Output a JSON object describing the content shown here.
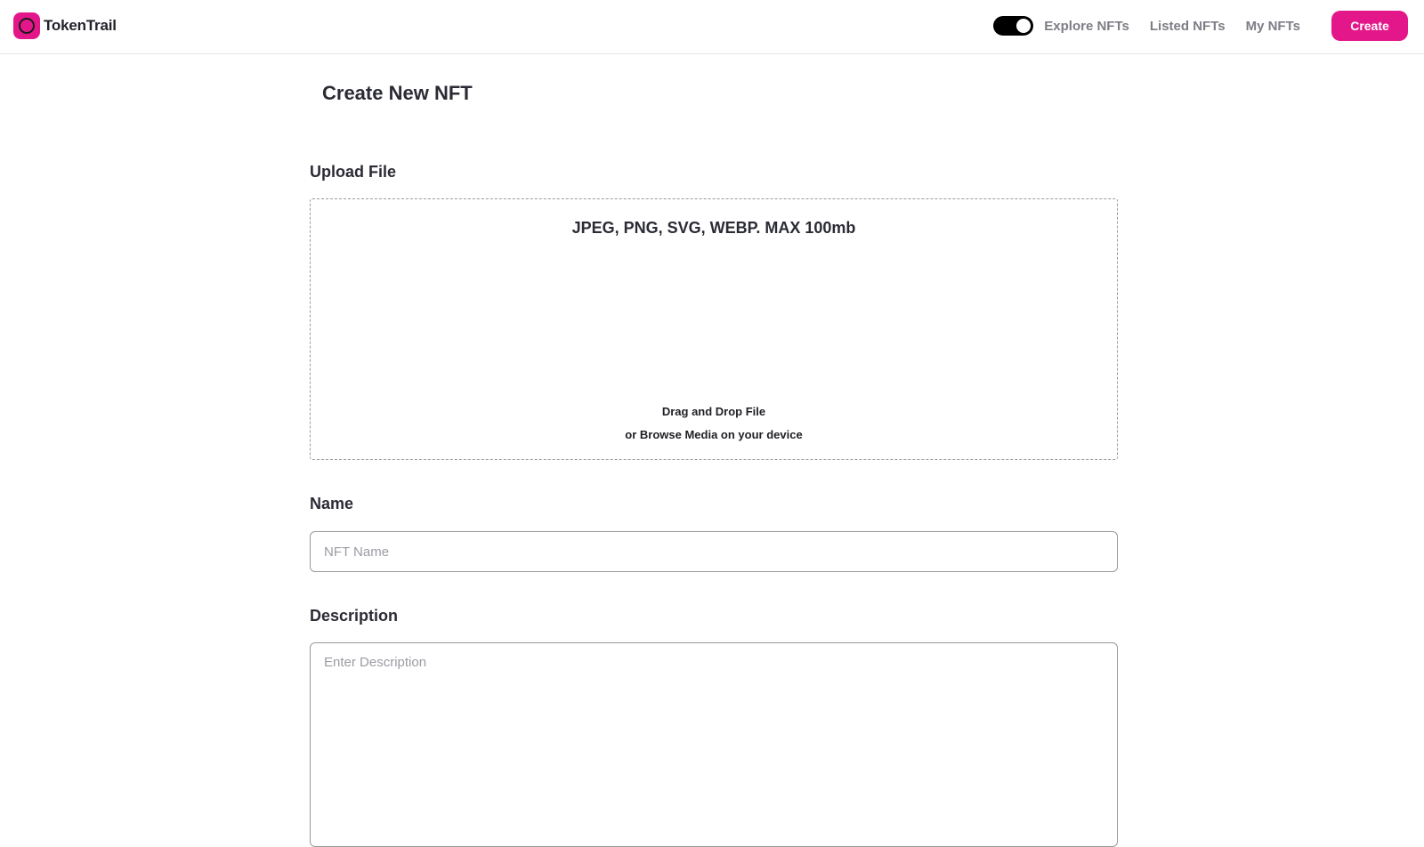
{
  "header": {
    "brand": "TokenTrail",
    "toggle_on": true,
    "nav": {
      "explore": "Explore NFTs",
      "listed": "Listed NFTs",
      "mine": "My NFTs"
    },
    "create_label": "Create"
  },
  "main": {
    "title": "Create New NFT",
    "upload": {
      "label": "Upload File",
      "formats": "JPEG, PNG, SVG, WEBP. MAX 100mb",
      "hint_line1": "Drag and Drop File",
      "hint_line2": "or Browse Media on your device"
    },
    "name": {
      "label": "Name",
      "placeholder": "NFT Name",
      "value": ""
    },
    "description": {
      "label": "Description",
      "placeholder": "Enter Description",
      "value": ""
    }
  },
  "icons": {
    "logo": "circle-logo-icon"
  },
  "colors": {
    "accent": "#e4178a",
    "toggle_track": "#000000",
    "nav_text": "#7d7d86",
    "border": "#9a9a9a"
  }
}
